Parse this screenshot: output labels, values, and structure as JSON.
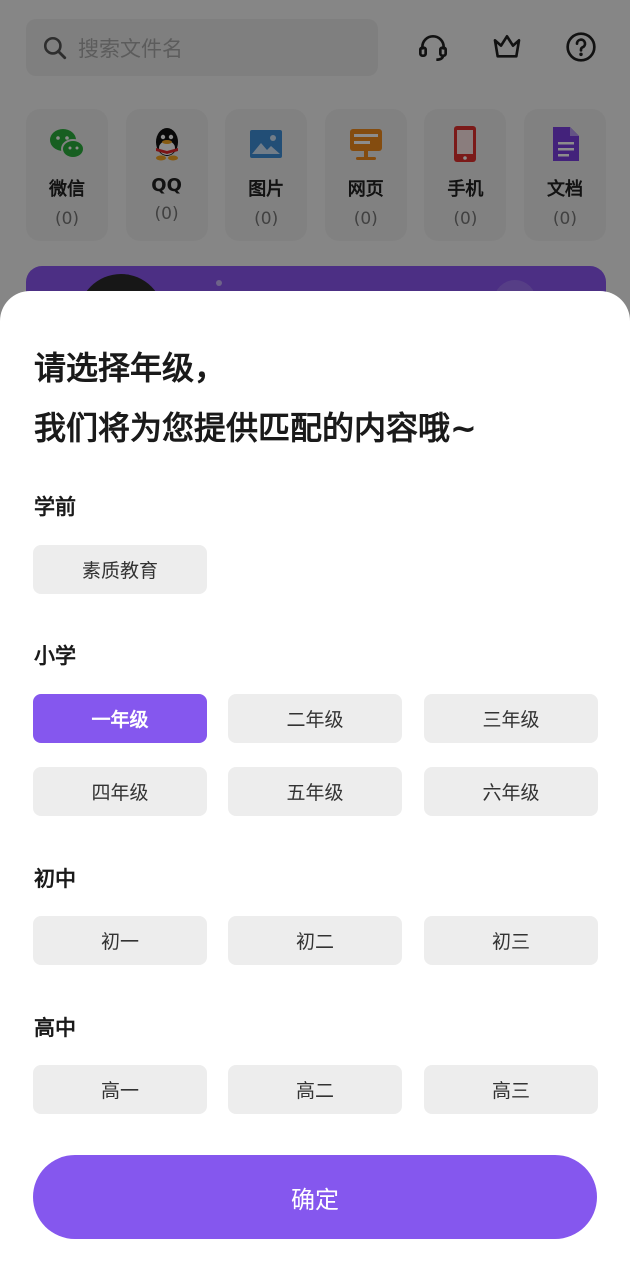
{
  "background": {
    "search": {
      "placeholder": "搜索文件名"
    },
    "top_icons": [
      "headset-icon",
      "crown-icon",
      "help-icon"
    ],
    "categories": [
      {
        "label": "微信",
        "count": "(0)",
        "icon": "wechat-icon"
      },
      {
        "label": "QQ",
        "count": "(0)",
        "icon": "qq-icon"
      },
      {
        "label": "图片",
        "count": "(0)",
        "icon": "image-icon"
      },
      {
        "label": "网页",
        "count": "(0)",
        "icon": "webpage-icon"
      },
      {
        "label": "手机",
        "count": "(0)",
        "icon": "phone-icon"
      },
      {
        "label": "文档",
        "count": "(0)",
        "icon": "document-icon"
      }
    ]
  },
  "sheet": {
    "headline_line1": "请选择年级，",
    "headline_line2": "我们将为您提供匹配的内容哦~",
    "sections": [
      {
        "title": "学前",
        "options": [
          "素质教育"
        ]
      },
      {
        "title": "小学",
        "options": [
          "一年级",
          "二年级",
          "三年级",
          "四年级",
          "五年级",
          "六年级"
        ]
      },
      {
        "title": "初中",
        "options": [
          "初一",
          "初二",
          "初三"
        ]
      },
      {
        "title": "高中",
        "options": [
          "高一",
          "高二",
          "高三"
        ]
      }
    ],
    "selected_option": "一年级",
    "confirm_label": "确定"
  },
  "colors": {
    "accent": "#8557ee",
    "chip_bg": "#ededed",
    "overlay": "rgba(0,0,0,0.45)"
  }
}
